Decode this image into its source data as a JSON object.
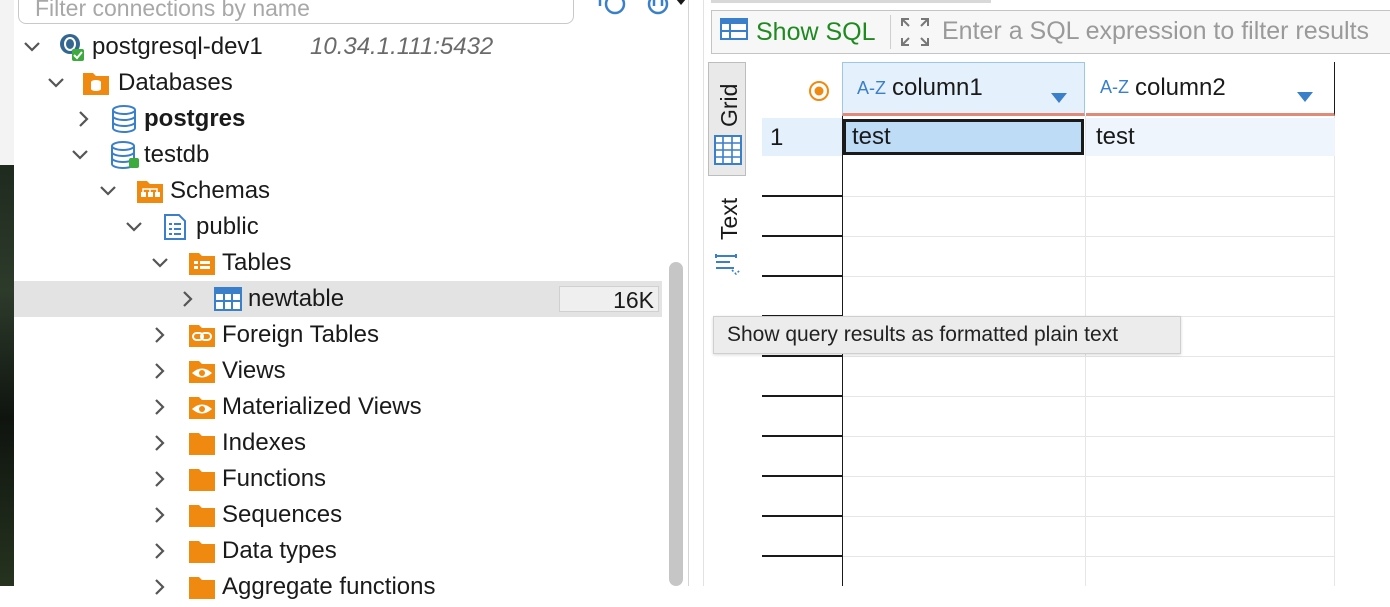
{
  "navigator": {
    "filter_placeholder": "Filter connections by name",
    "connection": {
      "name": "postgresql-dev1",
      "host": "10.34.1.111:5432"
    },
    "databases_label": "Databases",
    "db_postgres": "postgres",
    "db_testdb": "testdb",
    "schemas_label": "Schemas",
    "schema_public": "public",
    "tables_label": "Tables",
    "table_newtable": "newtable",
    "table_newtable_size": "16K",
    "folders": [
      "Foreign Tables",
      "Views",
      "Materialized Views",
      "Indexes",
      "Functions",
      "Sequences",
      "Data types",
      "Aggregate functions"
    ]
  },
  "toolbar": {
    "show_sql_label": "Show SQL",
    "filter_placeholder": "Enter a SQL expression to filter results"
  },
  "side_tabs": {
    "grid": "Grid",
    "text": "Text"
  },
  "grid": {
    "columns": [
      {
        "type_badge": "A-Z",
        "name": "column1"
      },
      {
        "type_badge": "A-Z",
        "name": "column2"
      }
    ],
    "rows": [
      {
        "num": "1",
        "cells": [
          "test",
          "test"
        ]
      }
    ]
  },
  "tooltip": "Show query results as formatted plain text",
  "colors": {
    "folder_orange": "#f0890f",
    "db_blue": "#3a7fc9",
    "show_sql_green": "#1f8a1f",
    "selected_cell_bg": "#bfdcf7",
    "header_accent": "#e08b7a"
  }
}
